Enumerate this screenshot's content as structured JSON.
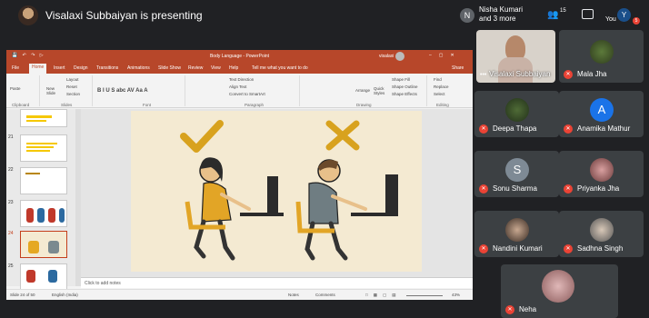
{
  "meet": {
    "presenting_text": "Visalaxi Subbaiyan is presenting",
    "notification": {
      "initial": "N",
      "line1": "Nisha Kumari",
      "line2": "and 3 more"
    },
    "people_count": "15",
    "you_label": "You",
    "you_initial": "Y",
    "you_badge": "5"
  },
  "ppt": {
    "title": "Body Language - PowerPoint",
    "user": "visalaxi",
    "tabs": [
      "File",
      "Home",
      "Insert",
      "Design",
      "Transitions",
      "Animations",
      "Slide Show",
      "Review",
      "View",
      "Help",
      "Tell me what you want to do",
      "Share"
    ],
    "ribbon": {
      "clipboard": "Clipboard",
      "slides": "Slides",
      "font": "Font",
      "paragraph": "Paragraph",
      "drawing": "Drawing",
      "editing": "Editing",
      "paste": "Paste",
      "new_slide": "New Slide",
      "layout": "Layout",
      "reset": "Reset",
      "section": "Section",
      "text_direction": "Text Direction",
      "align_text": "Align Text",
      "smartart": "Convert to SmartArt",
      "arrange": "Arrange",
      "quick_styles": "Quick Styles",
      "shape_fill": "Shape Fill",
      "shape_outline": "Shape Outline",
      "shape_effects": "Shape Effects",
      "find": "Find",
      "replace": "Replace",
      "select": "Select"
    },
    "thumb_numbers": [
      "21",
      "22",
      "23",
      "24",
      "25"
    ],
    "notes_placeholder": "Click to add notes",
    "status": {
      "slide": "Slide 24 of 50",
      "language": "English (India)",
      "notes": "Notes",
      "comments": "Comments",
      "zoom": "43%"
    }
  },
  "participants": [
    {
      "name": "Visalaxi Subbaiyan",
      "kind": "video"
    },
    {
      "name": "Mala Jha",
      "kind": "photo"
    },
    {
      "name": "Deepa Thapa",
      "kind": "photo"
    },
    {
      "name": "Anamika Mathur",
      "kind": "letter",
      "letter": "A",
      "color": "#1a73e8"
    },
    {
      "name": "Sonu Sharma",
      "kind": "letter",
      "letter": "S",
      "color": "#7e8a95"
    },
    {
      "name": "Priyanka Jha",
      "kind": "photo"
    },
    {
      "name": "Nandini Kumari",
      "kind": "photo"
    },
    {
      "name": "Sadhna Singh",
      "kind": "photo"
    },
    {
      "name": "Neha",
      "kind": "photo"
    }
  ]
}
